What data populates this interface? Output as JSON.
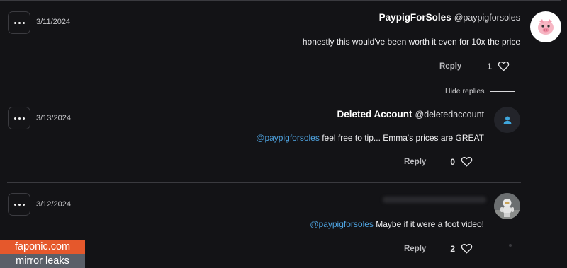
{
  "comments": [
    {
      "author": "PaypigForSoles",
      "handle": "@paypigforsoles",
      "date": "3/11/2024",
      "text": "honestly this would've been worth it even for 10x the price",
      "likes": "1",
      "reply_label": "Reply",
      "avatar_icon": "pig-avatar-icon"
    },
    {
      "author": "Deleted Account",
      "handle": "@deletedaccount",
      "date": "3/13/2024",
      "mention": "@paypigforsoles",
      "text": "feel free to tip... Emma's prices are GREAT",
      "likes": "0",
      "reply_label": "Reply",
      "avatar_icon": "user-icon"
    },
    {
      "author": "",
      "handle": "",
      "date": "3/12/2024",
      "mention": "@paypigforsoles",
      "text": "Maybe if it were a foot video!",
      "likes": "2",
      "reply_label": "Reply",
      "avatar_icon": "astronaut-avatar-icon"
    }
  ],
  "hide_replies_label": "Hide replies",
  "watermark": {
    "site": "faponic.com",
    "tagline": "mirror leaks"
  },
  "colors": {
    "background": "#131316",
    "mention": "#4ea3e0",
    "watermark_accent": "#e5582c"
  }
}
